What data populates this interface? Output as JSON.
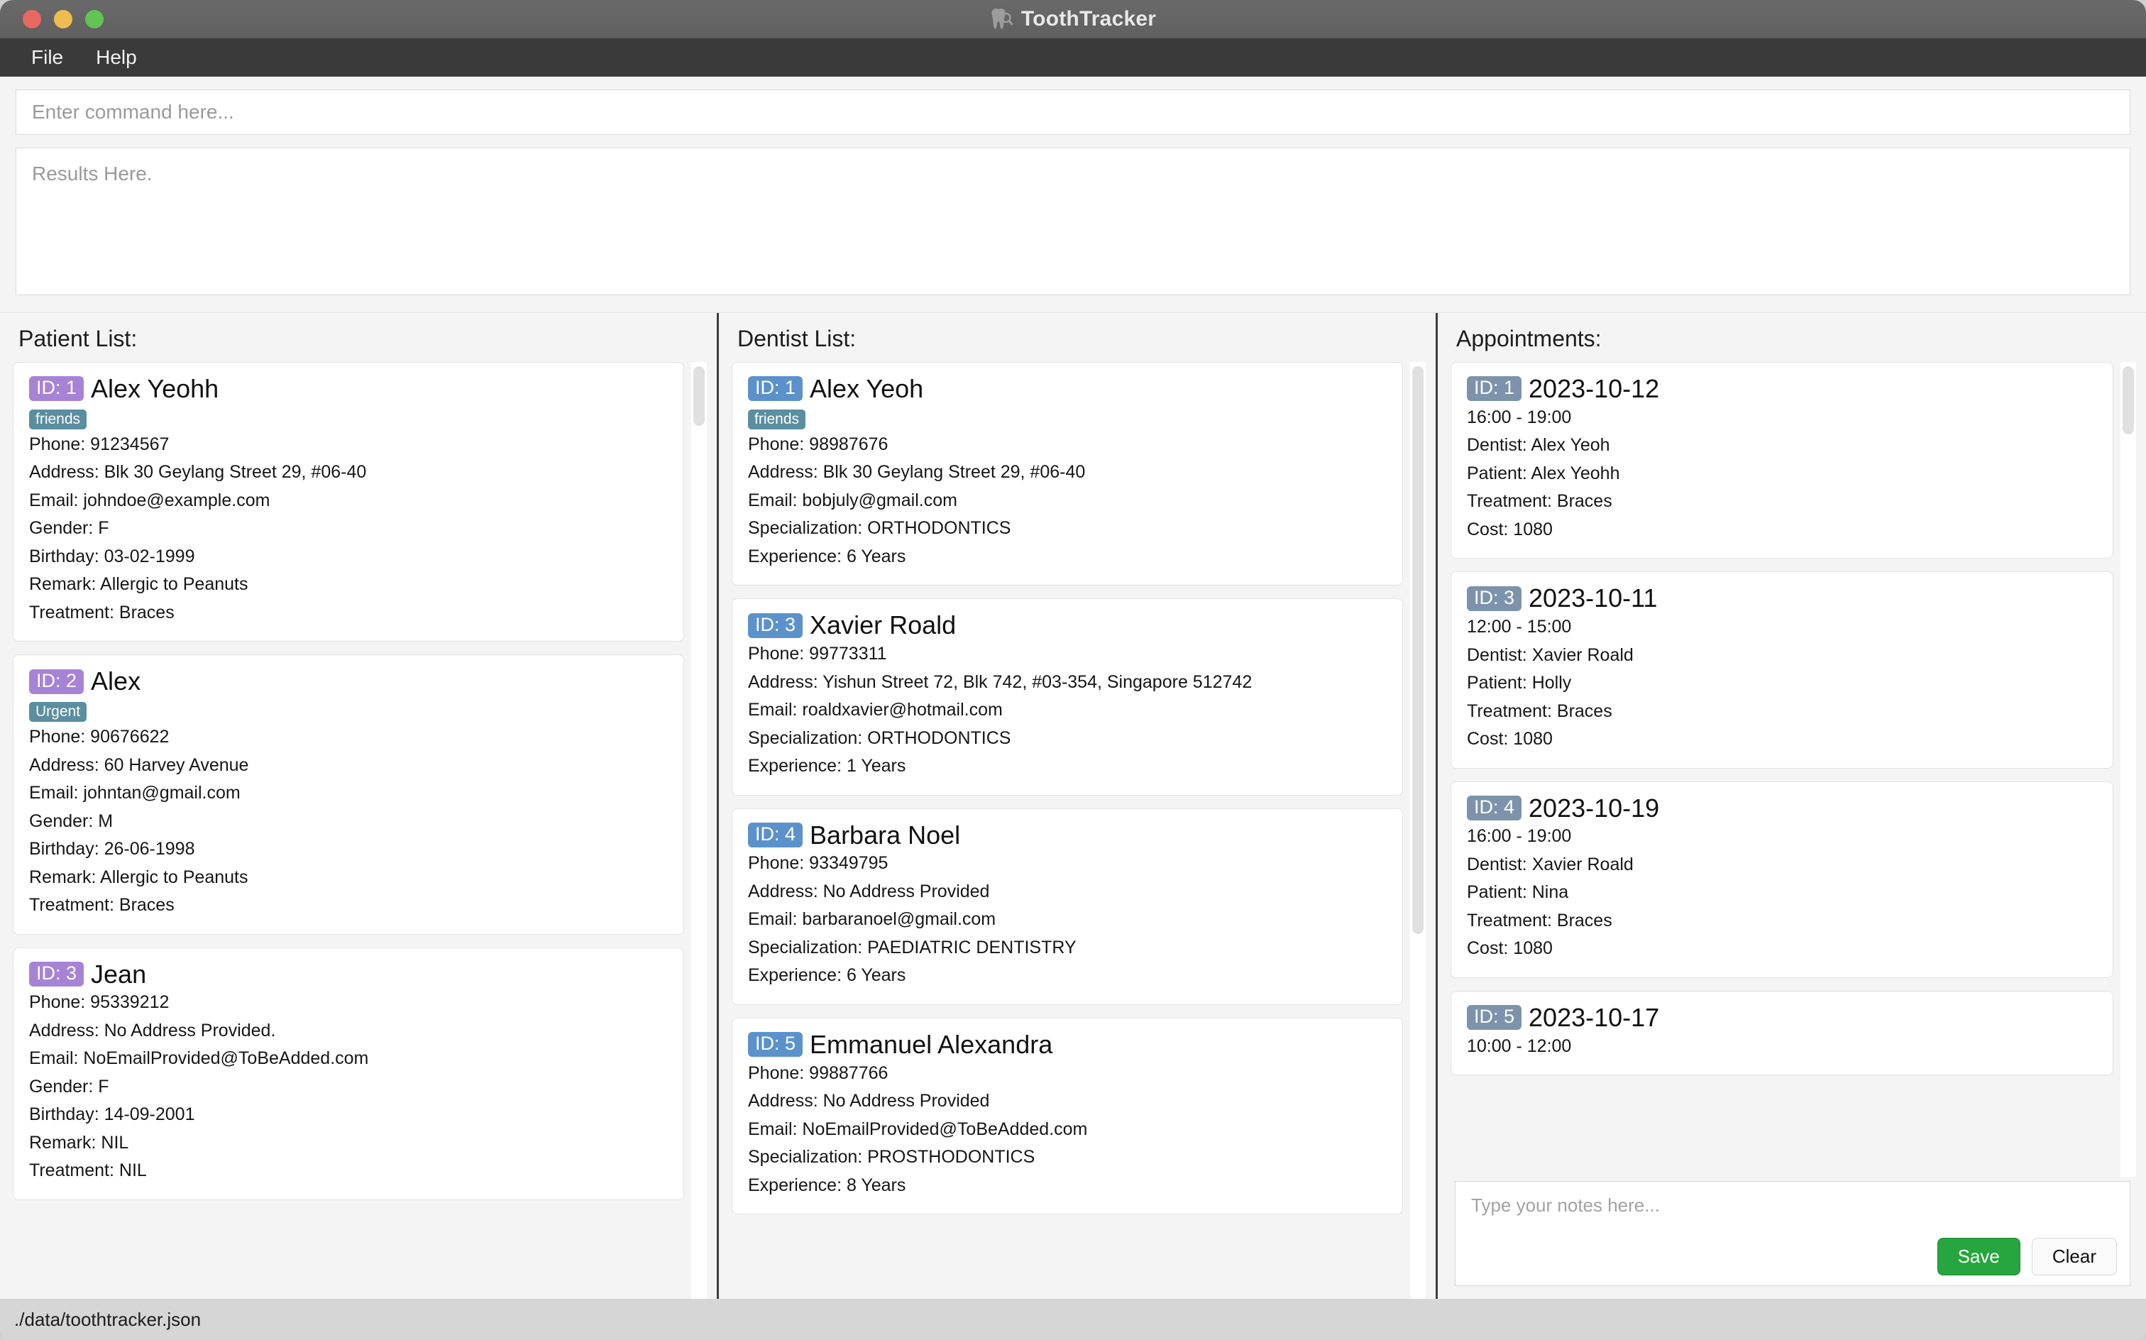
{
  "window": {
    "title": "ToothTracker",
    "tooth_icon": "tooth-magnifier-icon",
    "controls": [
      "close",
      "minimize",
      "maximize"
    ]
  },
  "menubar": {
    "items": [
      {
        "label": "File"
      },
      {
        "label": "Help"
      }
    ]
  },
  "command": {
    "placeholder": "Enter command here..."
  },
  "results": {
    "placeholder": "Results Here."
  },
  "patients": {
    "title": "Patient List:",
    "items": [
      {
        "id": "ID: 1",
        "name": "Alex Yeohh",
        "tag": "friends",
        "phone": "Phone: 91234567",
        "address": "Address: Blk 30 Geylang Street 29, #06-40",
        "email": "Email: johndoe@example.com",
        "gender": "Gender: F",
        "birthday": "Birthday: 03-02-1999",
        "remark": "Remark: Allergic to Peanuts",
        "treatment": "Treatment: Braces"
      },
      {
        "id": "ID: 2",
        "name": "Alex",
        "tag": "Urgent",
        "phone": "Phone: 90676622",
        "address": "Address: 60 Harvey Avenue",
        "email": "Email: johntan@gmail.com",
        "gender": "Gender: M",
        "birthday": "Birthday: 26-06-1998",
        "remark": "Remark: Allergic to Peanuts",
        "treatment": "Treatment: Braces"
      },
      {
        "id": "ID: 3",
        "name": "Jean",
        "tag": "",
        "phone": "Phone: 95339212",
        "address": "Address: No Address Provided.",
        "email": "Email: NoEmailProvided@ToBeAdded.com",
        "gender": "Gender: F",
        "birthday": "Birthday: 14-09-2001",
        "remark": "Remark: NIL",
        "treatment": "Treatment: NIL"
      }
    ]
  },
  "dentists": {
    "title": "Dentist List:",
    "items": [
      {
        "id": "ID: 1",
        "name": "Alex Yeoh",
        "tag": "friends",
        "phone": "Phone: 98987676",
        "address": "Address: Blk 30 Geylang Street 29, #06-40",
        "email": "Email: bobjuly@gmail.com",
        "specialization": "Specialization: ORTHODONTICS",
        "experience": "Experience: 6 Years"
      },
      {
        "id": "ID: 3",
        "name": "Xavier Roald",
        "tag": "",
        "phone": "Phone: 99773311",
        "address": "Address: Yishun Street 72, Blk 742, #03-354, Singapore 512742",
        "email": "Email: roaldxavier@hotmail.com",
        "specialization": "Specialization: ORTHODONTICS",
        "experience": "Experience: 1 Years"
      },
      {
        "id": "ID: 4",
        "name": "Barbara Noel",
        "tag": "",
        "phone": "Phone: 93349795",
        "address": "Address: No Address Provided",
        "email": "Email: barbaranoel@gmail.com",
        "specialization": "Specialization: PAEDIATRIC DENTISTRY",
        "experience": "Experience: 6 Years"
      },
      {
        "id": "ID: 5",
        "name": "Emmanuel Alexandra",
        "tag": "",
        "phone": "Phone: 99887766",
        "address": "Address: No Address Provided",
        "email": "Email: NoEmailProvided@ToBeAdded.com",
        "specialization": "Specialization: PROSTHODONTICS",
        "experience": "Experience: 8 Years"
      }
    ]
  },
  "appointments": {
    "title": "Appointments:",
    "items": [
      {
        "id": "ID: 1",
        "date": "2023-10-12",
        "time": "16:00 - 19:00",
        "dentist": "Dentist: Alex Yeoh",
        "patient": "Patient: Alex Yeohh",
        "treatment": "Treatment: Braces",
        "cost": "Cost: 1080"
      },
      {
        "id": "ID: 3",
        "date": "2023-10-11",
        "time": "12:00 - 15:00",
        "dentist": "Dentist: Xavier Roald",
        "patient": "Patient: Holly",
        "treatment": "Treatment: Braces",
        "cost": "Cost: 1080"
      },
      {
        "id": "ID: 4",
        "date": "2023-10-19",
        "time": "16:00 - 19:00",
        "dentist": "Dentist: Xavier Roald",
        "patient": "Patient: Nina",
        "treatment": "Treatment: Braces",
        "cost": "Cost: 1080"
      },
      {
        "id": "ID: 5",
        "date": "2023-10-17",
        "time": "10:00 - 12:00",
        "dentist": "",
        "patient": "",
        "treatment": "",
        "cost": ""
      }
    ]
  },
  "notes": {
    "placeholder": "Type your notes here...",
    "save_label": "Save",
    "clear_label": "Clear"
  },
  "statusbar": {
    "path": "./data/toothtracker.json"
  },
  "colors": {
    "patient_badge": "#a783d6",
    "dentist_badge": "#5b92cc",
    "appointment_badge": "#7d93ab",
    "tag": "#5a8ea0",
    "save_button": "#27a53f",
    "titlebar": "#5f5f5f",
    "menubar": "#3a3a3a"
  }
}
